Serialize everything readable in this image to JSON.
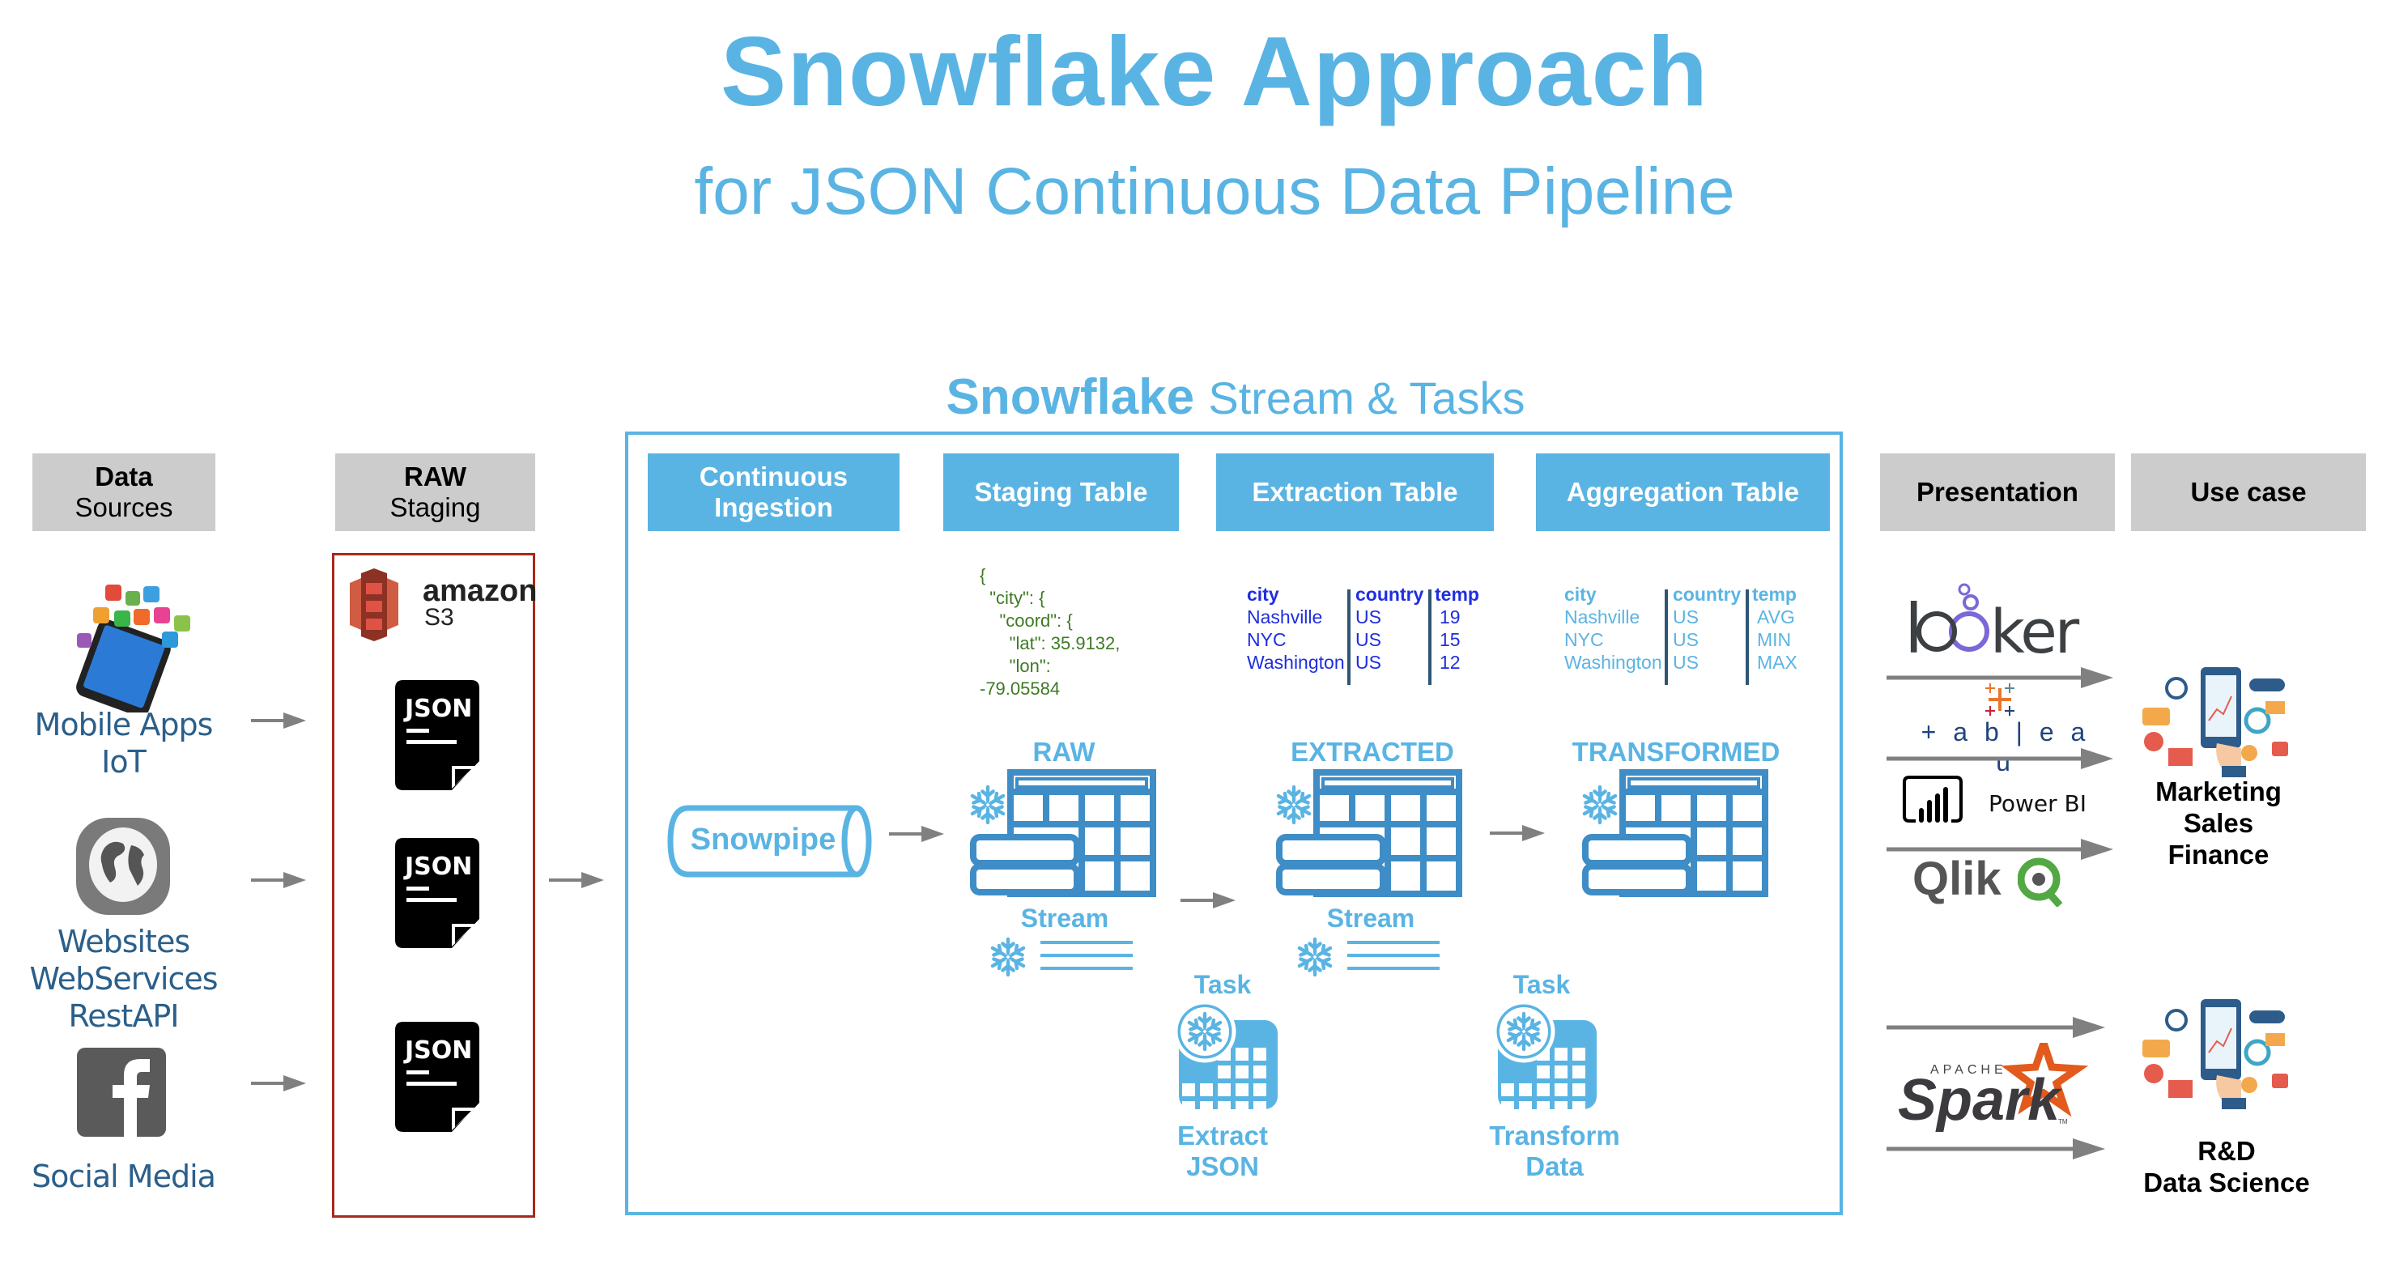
{
  "title": "Snowflake Approach",
  "subtitle": "for JSON Continuous Data Pipeline",
  "snowflake_section": {
    "heading_bold": "Snowflake",
    "heading_rest": "Stream & Tasks"
  },
  "colors": {
    "accent": "#5AB4E3",
    "table_icon": "#3F8DC6",
    "header_gray": "#CCCCCC",
    "staging_border": "#A8291B",
    "arrow": "#808080",
    "source_text": "#2B5F8A",
    "json_text": "#3E7A24",
    "extraction_text": "#1F2EE0"
  },
  "columns": {
    "data_sources": {
      "line1": "Data",
      "line2": "Sources"
    },
    "raw_staging": {
      "line1": "RAW",
      "line2": "Staging"
    },
    "continuous_ingestion": {
      "line1": "Continuous",
      "line2": "Ingestion"
    },
    "staging_table": "Staging Table",
    "extraction_table": "Extraction Table",
    "aggregation_table": "Aggregation Table",
    "presentation": "Presentation",
    "use_case": "Use case"
  },
  "sources": [
    {
      "icon": "mobile-apps-icon",
      "line1": "Mobile Apps",
      "line2": "IoT"
    },
    {
      "icon": "globe-icon",
      "line1": "Websites",
      "line2": "WebServices",
      "line3": "RestAPI"
    },
    {
      "icon": "facebook-icon",
      "line1": "Social Media"
    }
  ],
  "staging": {
    "s3_brand": "amazon",
    "s3_product": "S3",
    "file_label": "JSON",
    "file_count": 3
  },
  "ingestion": {
    "snowpipe_label": "Snowpipe"
  },
  "staging_table": {
    "json_sample": "{\n  \"city\": {\n    \"coord\": {\n      \"lat\": 35.9132,\n      \"lon\":\n-79.05584",
    "icon_label": "RAW",
    "stream_label": "Stream"
  },
  "extraction_table": {
    "headers": [
      "city",
      "country",
      "temp"
    ],
    "rows": [
      [
        "Nashville",
        "US",
        "19"
      ],
      [
        "NYC",
        "US",
        "15"
      ],
      [
        "Washington",
        "US",
        "12"
      ]
    ],
    "icon_label": "EXTRACTED",
    "stream_label": "Stream"
  },
  "aggregation_table": {
    "headers": [
      "city",
      "country",
      "temp"
    ],
    "rows": [
      [
        "Nashville",
        "US",
        "AVG"
      ],
      [
        "NYC",
        "US",
        "MIN"
      ],
      [
        "Washington",
        "US",
        "MAX"
      ]
    ],
    "icon_label": "TRANSFORMED"
  },
  "tasks": [
    {
      "title": "Task",
      "line1": "Extract",
      "line2": "JSON"
    },
    {
      "title": "Task",
      "line1": "Transform",
      "line2": "Data"
    }
  ],
  "presentation_tools": [
    {
      "name": "looker",
      "label": "looker"
    },
    {
      "name": "tableau",
      "label": "+ a b | e a u"
    },
    {
      "name": "power-bi",
      "label": "Power BI"
    },
    {
      "name": "qlik",
      "label": "Qlik"
    },
    {
      "name": "spark",
      "label_small": "APACHE",
      "label": "Spark",
      "tm": "TM"
    }
  ],
  "use_cases": [
    {
      "line1": "Marketing",
      "line2": "Sales",
      "line3": "Finance"
    },
    {
      "line1": "R&D",
      "line2": "Data Science"
    }
  ]
}
